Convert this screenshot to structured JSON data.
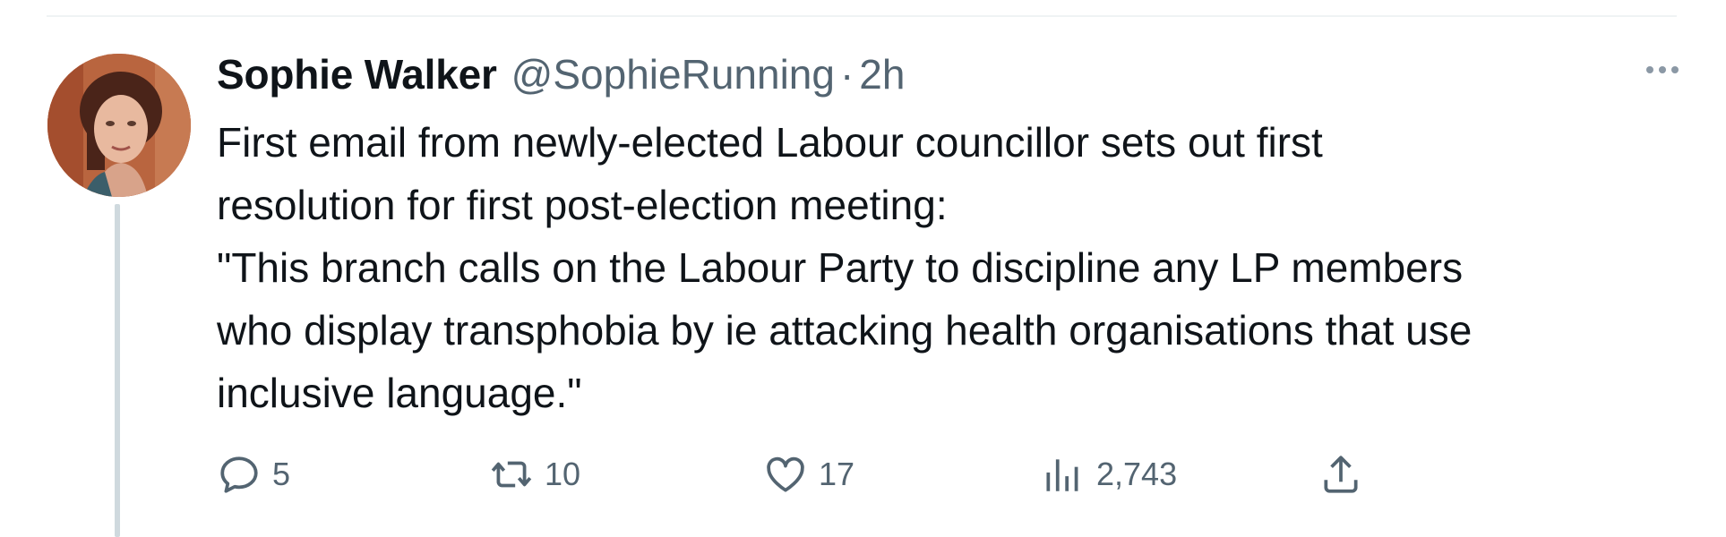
{
  "tweet": {
    "author": {
      "display_name": "Sophie Walker",
      "handle": "@SophieRunning",
      "avatar": "avatar-photo"
    },
    "separator": "·",
    "time": "2h",
    "text_lines": [
      "First email from newly-elected Labour councillor sets out first",
      "resolution for first post-election meeting:",
      "\"This branch calls on the Labour Party to discipline any LP members",
      "who display transphobia by ie attacking health organisations that use",
      "inclusive language.\""
    ],
    "actions": {
      "reply": {
        "icon": "reply-icon",
        "count": "5"
      },
      "retweet": {
        "icon": "retweet-icon",
        "count": "10"
      },
      "like": {
        "icon": "heart-icon",
        "count": "17"
      },
      "views": {
        "icon": "views-icon",
        "count": "2,743"
      },
      "share": {
        "icon": "share-icon"
      }
    },
    "more": {
      "icon": "more-icon"
    }
  },
  "colors": {
    "text_primary": "#0f1419",
    "text_secondary": "#536471",
    "divider": "#eff3f4",
    "thread_line": "#cfd9de"
  }
}
